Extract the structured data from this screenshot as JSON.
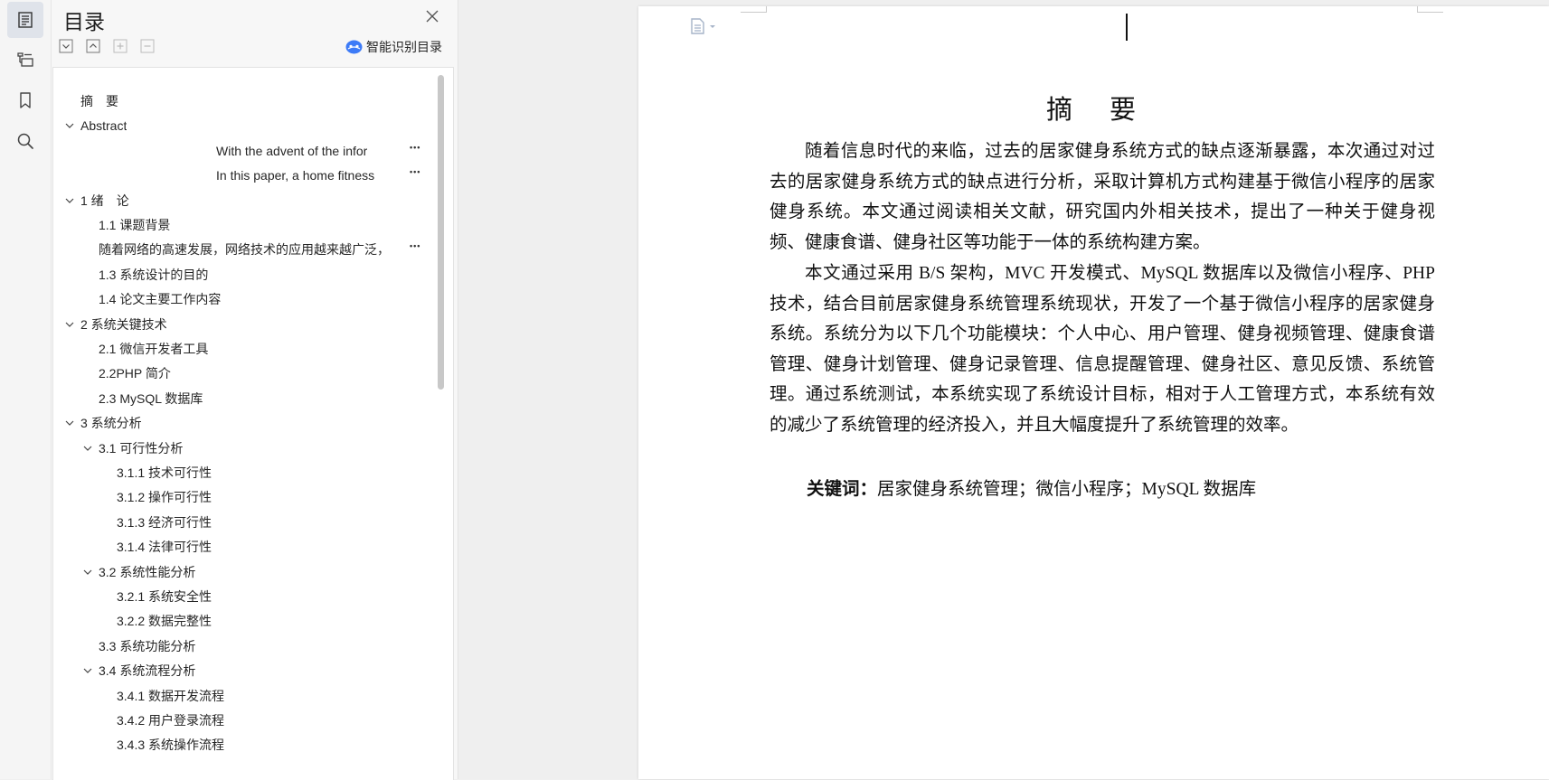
{
  "panel": {
    "title": "目录",
    "smart_toc_label": "智能识别目录"
  },
  "toc_items": [
    {
      "label": "摘　要",
      "level": 0,
      "expandable": false
    },
    {
      "label": "Abstract",
      "level": 0,
      "expandable": true
    },
    {
      "label": "With the advent of the infor",
      "level": 4,
      "expandable": false,
      "truncated": true
    },
    {
      "label": "In this paper, a home fitness",
      "level": 4,
      "expandable": false,
      "truncated": true
    },
    {
      "label": "1 绪　论",
      "level": 0,
      "expandable": true
    },
    {
      "label": "1.1 课题背景",
      "level": 1,
      "expandable": false
    },
    {
      "label": "随着网络的高速发展，网络技术的应用越来越广泛，",
      "level": 1,
      "expandable": false,
      "truncated": true
    },
    {
      "label": "1.3 系统设计的目的",
      "level": 1,
      "expandable": false
    },
    {
      "label": "1.4  论文主要工作内容",
      "level": 1,
      "expandable": false
    },
    {
      "label": "2  系统关键技术",
      "level": 0,
      "expandable": true
    },
    {
      "label": "2.1 微信开发者工具",
      "level": 1,
      "expandable": false
    },
    {
      "label": "2.2PHP 简介",
      "level": 1,
      "expandable": false
    },
    {
      "label": "2.3 MySQL 数据库",
      "level": 1,
      "expandable": false
    },
    {
      "label": "3  系统分析",
      "level": 0,
      "expandable": true
    },
    {
      "label": "3.1  可行性分析",
      "level": 1,
      "expandable": true
    },
    {
      "label": "3.1.1  技术可行性",
      "level": 2,
      "expandable": false
    },
    {
      "label": "3.1.2  操作可行性",
      "level": 2,
      "expandable": false
    },
    {
      "label": "3.1.3  经济可行性",
      "level": 2,
      "expandable": false
    },
    {
      "label": "3.1.4  法律可行性",
      "level": 2,
      "expandable": false
    },
    {
      "label": "3.2  系统性能分析",
      "level": 1,
      "expandable": true
    },
    {
      "label": "3.2.1  系统安全性",
      "level": 2,
      "expandable": false
    },
    {
      "label": "3.2.2  数据完整性",
      "level": 2,
      "expandable": false
    },
    {
      "label": "3.3  系统功能分析",
      "level": 1,
      "expandable": false
    },
    {
      "label": "3.4  系统流程分析",
      "level": 1,
      "expandable": true
    },
    {
      "label": "3.4.1  数据开发流程",
      "level": 2,
      "expandable": false
    },
    {
      "label": "3.4.2  用户登录流程",
      "level": 2,
      "expandable": false
    },
    {
      "label": "3.4.3  系统操作流程",
      "level": 2,
      "expandable": false
    }
  ],
  "document": {
    "heading": "摘　要",
    "paragraph1": "随着信息时代的来临，过去的居家健身系统方式的缺点逐渐暴露，本次通过对过去的居家健身系统方式的缺点进行分析，采取计算机方式构建基于微信小程序的居家健身系统。本文通过阅读相关文献，研究国内外相关技术，提出了一种关于健身视频、健康食谱、健身社区等功能于一体的系统构建方案。",
    "paragraph2": "本文通过采用 B/S 架构，MVC 开发模式、MySQL 数据库以及微信小程序、PHP 技术，结合目前居家健身系统管理系统现状，开发了一个基于微信小程序的居家健身系统。系统分为以下几个功能模块：个人中心、用户管理、健身视频管理、健康食谱管理、健身计划管理、健身记录管理、信息提醒管理、健身社区、意见反馈、系统管理。通过系统测试，本系统实现了系统设计目标，相对于人工管理方式，本系统有效的减少了系统管理的经济投入，并且大幅度提升了系统管理的效率。",
    "keywords_label": "关键词：",
    "keywords_value": "居家健身系统管理；微信小程序；MySQL 数据库"
  },
  "icons": {
    "rail": [
      "toc-icon",
      "outline-icon",
      "bookmark-icon",
      "search-icon"
    ],
    "toolbar": [
      "collapse-all-icon",
      "expand-up-icon",
      "add-heading-icon",
      "remove-heading-icon"
    ],
    "close": "close-icon",
    "smart": "ai-cloud-icon",
    "page": "page-layout-icon"
  },
  "colors": {
    "accent": "#3d7bf7",
    "rail_active": "#dfe3ea"
  }
}
